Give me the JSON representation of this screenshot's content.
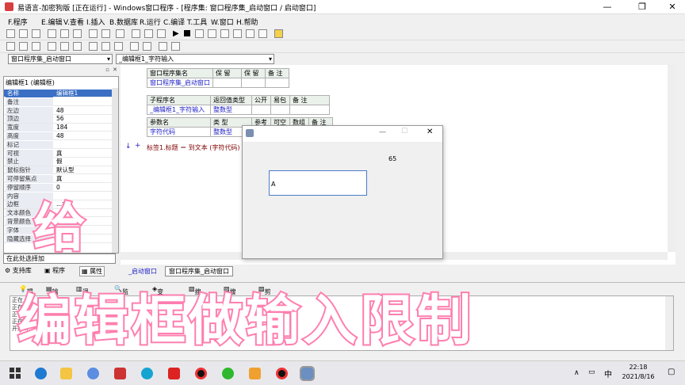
{
  "window": {
    "title": "易语言-加密狗版 [正在运行] - Windows窗口程序 - [程序集: 窗口程序集_启动窗口 / 启动窗口]",
    "minimize": "—",
    "maximize": "❐",
    "close": "✕"
  },
  "menu": [
    "F.程序",
    "E.编辑",
    "V.查看",
    "I.插入",
    "B.数据库",
    "R.运行",
    "C.编译",
    "T.工具",
    "W.窗口",
    "H.帮助"
  ],
  "combos": {
    "left": "窗口程序集_启动窗口",
    "right": "_编辑框1_字符输入"
  },
  "property_panel": {
    "header": "编辑框1 (编辑框)",
    "rows": [
      [
        "名称",
        "编辑框1"
      ],
      [
        "备注",
        ""
      ],
      [
        "左边",
        "48"
      ],
      [
        "顶边",
        "56"
      ],
      [
        "宽度",
        "184"
      ],
      [
        "高度",
        "48"
      ],
      [
        "标记",
        ""
      ],
      [
        "可视",
        "真"
      ],
      [
        "禁止",
        "假"
      ],
      [
        "鼠标指针",
        "默认型"
      ],
      [
        "可停留焦点",
        "真"
      ],
      [
        "停留顺序",
        "0"
      ],
      [
        "内容",
        ""
      ],
      [
        "边框",
        "...式"
      ],
      [
        "文本颜色",
        ""
      ],
      [
        "背景颜色",
        ""
      ],
      [
        "字体",
        ""
      ],
      [
        "隐藏选择",
        ""
      ]
    ],
    "footer": "在此处选择加",
    "tabs": [
      "支持库",
      "程序",
      "属性"
    ]
  },
  "table1": {
    "headers": [
      "窗口程序集名",
      "保 留",
      "保 留",
      "备 注"
    ],
    "row": "窗口程序集_启动窗口"
  },
  "table2": {
    "headers": [
      "子程序名",
      "返回值类型",
      "公开",
      "易包",
      "备 注"
    ],
    "name": "_编辑框1_字符输入",
    "ret": "整数型",
    "param_headers": [
      "参数名",
      "类 型",
      "参考",
      "可空",
      "数组",
      "备 注"
    ],
    "param_name": "字符代码",
    "param_type": "整数型"
  },
  "code_line": "标签1.标题 ＝ 到文本 (字符代码)",
  "dialog": {
    "min": "—",
    "max": "☐",
    "close": "✕",
    "label_value": "65",
    "edit_value": "A"
  },
  "editor_tabs": [
    "_启动窗口",
    "窗口程序集_启动窗口"
  ],
  "bottom_tabs": [
    "提示",
    "输出",
    "调用表",
    "监视表",
    "变量表",
    "搜寻1",
    "搜寻2",
    "剪辑历史"
  ],
  "output_lines": [
    "正在...",
    "正在...",
    "正在...",
    "正在...",
    "开始..."
  ],
  "overlay": {
    "char": "给",
    "caption": "编辑框做输入限制"
  },
  "taskbar": {
    "time": "22:18",
    "date": "2021/8/16",
    "ime": "中"
  }
}
